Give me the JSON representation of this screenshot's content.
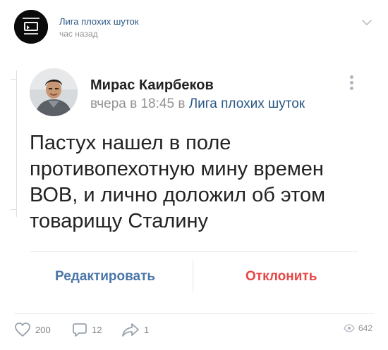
{
  "header": {
    "group_name": "Лига плохих шуток",
    "time": "час назад",
    "avatar_icon": "group-logo-icon"
  },
  "repost": {
    "author_name": "Мирас Каирбеков",
    "meta_time": "вчера в 18:45 в ",
    "meta_group": "Лига плохих шуток",
    "text": "Пастух нашел в поле противопехотную мину времен ВОВ, и лично доложил об этом товарищу Сталину"
  },
  "actions": {
    "edit_label": "Редактировать",
    "decline_label": "Отклонить"
  },
  "footer": {
    "likes": "200",
    "comments": "12",
    "shares": "1",
    "views": "642"
  },
  "colors": {
    "link": "#2a5885",
    "edit": "#4a76a8",
    "decline": "#e64646",
    "muted": "#939393"
  }
}
